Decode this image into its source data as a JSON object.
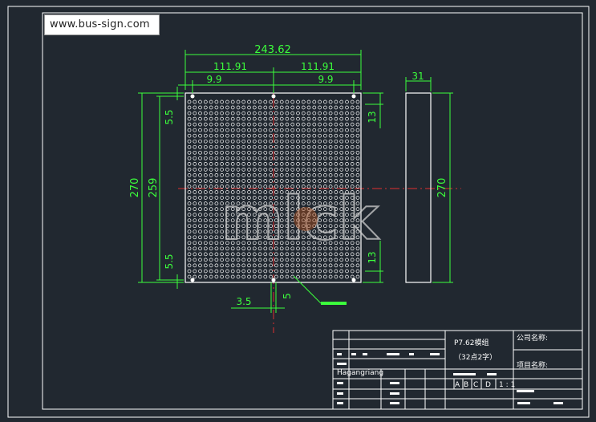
{
  "watermark_url": "www.bus-sign.com",
  "brand_watermark": "mlck",
  "dimensions": {
    "overall_width": "243.62",
    "half_left": "111.91",
    "half_right": "111.91",
    "edge_left": "9.9",
    "edge_right": "9.9",
    "depth": "31",
    "height_outer": "270",
    "height_inner": "259",
    "margin_top_left": "5.5",
    "margin_bottom_left": "5.5",
    "margin_top_right": "13",
    "margin_bottom_right": "13",
    "side_height": "270",
    "hole_offset": "3.5",
    "hole_size": "5"
  },
  "title_block": {
    "product_line1": "P7.62模组",
    "product_line2": "（32点2字）",
    "company_label": "公司名称:",
    "project_label": "项目名称:",
    "designer_label": "Hagangriang",
    "grid_a": "A",
    "grid_b": "B",
    "grid_c": "C",
    "grid_d": "D",
    "scale": "1 : 1"
  },
  "colors": {
    "background": "#212830",
    "dimension": "#3cff3c",
    "outline": "#ffffff",
    "centerline": "#e03030"
  }
}
